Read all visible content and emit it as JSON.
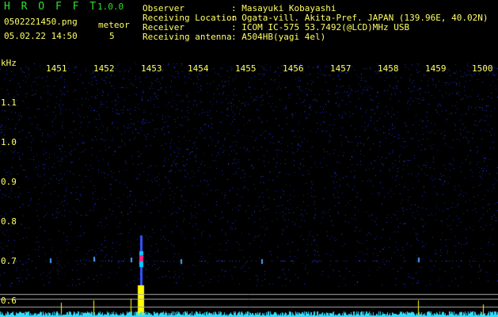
{
  "app": {
    "name": "H R O F F T",
    "version": "1.0.0",
    "filename": "0502221450.png",
    "datetime": "05.02.22 14:50",
    "meteor_label": "meteor",
    "meteor_count": "5"
  },
  "info": {
    "observer_label": "Observer",
    "observer_value": ": Masayuki Kobayashi",
    "location_label": "Receiving Location",
    "location_value": ": Ogata-vill. Akita-Pref. JAPAN (139.96E, 40.02N)",
    "receiver_label": "Receiver",
    "receiver_value": ": ICOM IC-575 53.7492(@LCD)MHz USB",
    "antenna_label": "Receiving antenna",
    "antenna_value": ": A504HB(yagi 4el)"
  },
  "plot": {
    "freq_unit": "kHz",
    "time_ticks": [
      "1451",
      "1452",
      "1453",
      "1454",
      "1455",
      "1456",
      "1457",
      "1458",
      "1459",
      "1500"
    ],
    "freq_ticks": [
      "1.1",
      "1.0",
      "0.9",
      "0.8",
      "0.7",
      "0.6"
    ],
    "colors": {
      "background": "#000000",
      "noise": "#1a2fd0",
      "signal": "#ffff00",
      "grid": "#aaaaaa",
      "text": "#ffff66",
      "title": "#33dd33"
    }
  }
}
